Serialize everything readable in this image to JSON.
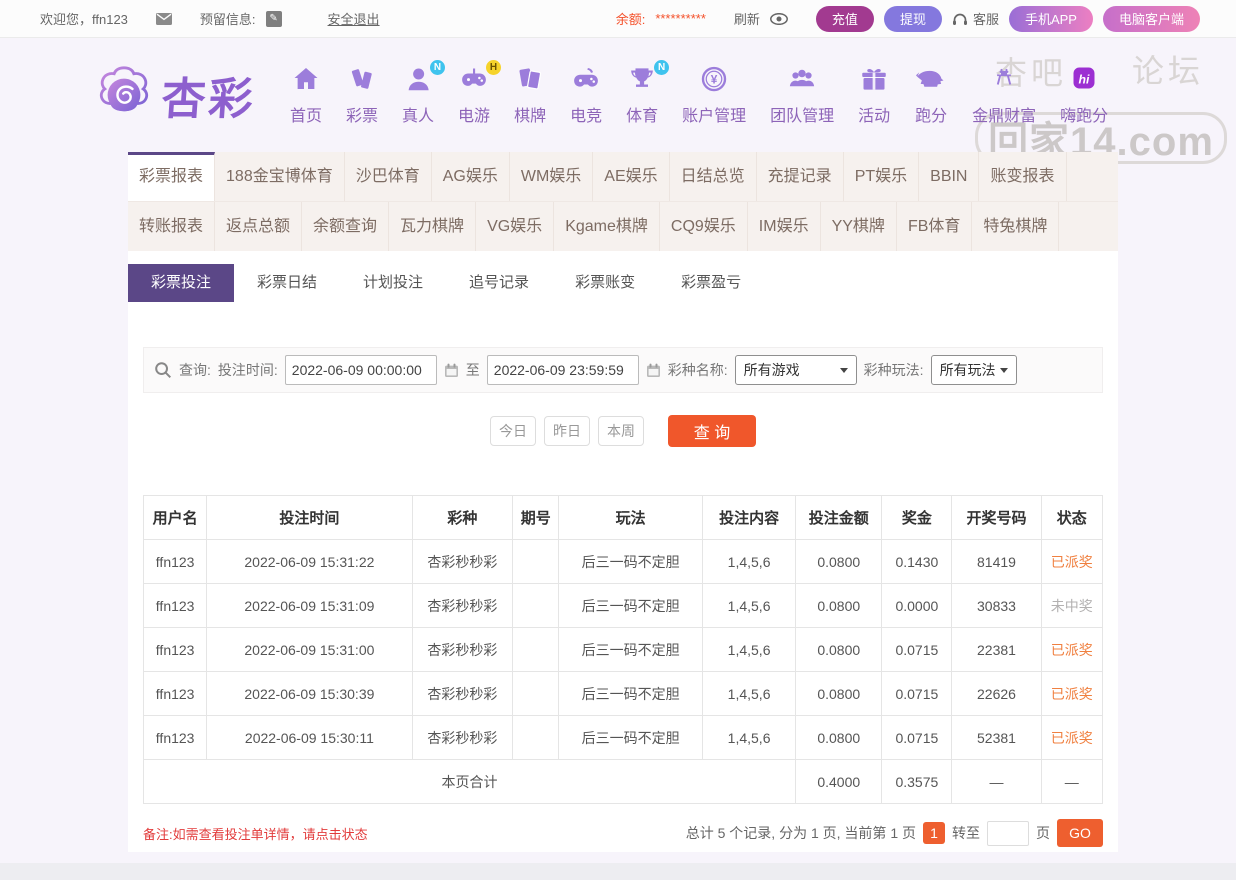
{
  "colors": {
    "brand_purple": "#5b4787",
    "nav_purple": "#8d64b8",
    "accent_orange": "#f0572b",
    "status_paid": "#f08040",
    "status_lost": "#b3b1b1",
    "balance_red": "#f4512b",
    "deposit_bg": "#a23a90",
    "withdraw_bg": "#8478de"
  },
  "topbar": {
    "welcome": "欢迎您，ffn123",
    "reserved_label": "预留信息:",
    "logout": "安全退出",
    "balance_label": "余额:",
    "balance_value": "**********",
    "refresh": "刷新",
    "deposit": "充值",
    "withdraw": "提现",
    "service": "客服",
    "mobile_app": "手机APP",
    "pc_client": "电脑客户端"
  },
  "header": {
    "logo_text": "杏彩",
    "nav": [
      {
        "label": "首页"
      },
      {
        "label": "彩票"
      },
      {
        "label": "真人",
        "badge": "N"
      },
      {
        "label": "电游",
        "badge": "H"
      },
      {
        "label": "棋牌"
      },
      {
        "label": "电竞"
      },
      {
        "label": "体育",
        "badge": "N"
      },
      {
        "label": "账户管理"
      },
      {
        "label": "团队管理"
      },
      {
        "label": "活动"
      },
      {
        "label": "跑分"
      },
      {
        "label": "金鼎财富"
      },
      {
        "label": "嗨跑分"
      }
    ],
    "watermark": {
      "left": "杏吧",
      "right": "论坛",
      "center": "回家14.com"
    }
  },
  "tabs_row1": [
    "彩票报表",
    "188金宝博体育",
    "沙巴体育",
    "AG娱乐",
    "WM娱乐",
    "AE娱乐",
    "日结总览",
    "充提记录",
    "PT娱乐",
    "BBIN",
    "账变报表"
  ],
  "tabs_row2": [
    "转账报表",
    "返点总额",
    "余额查询",
    "瓦力棋牌",
    "VG娱乐",
    "Kgame棋牌",
    "CQ9娱乐",
    "IM娱乐",
    "YY棋牌",
    "FB体育",
    "特兔棋牌"
  ],
  "subtabs": [
    "彩票投注",
    "彩票日结",
    "计划投注",
    "追号记录",
    "彩票账变",
    "彩票盈亏"
  ],
  "filters": {
    "query_label": "查询:",
    "time_label": "投注时间:",
    "time_from": "2022-06-09 00:00:00",
    "to_label": "至",
    "time_to": "2022-06-09 23:59:59",
    "lottery_label": "彩种名称:",
    "lottery_value": "所有游戏",
    "play_label": "彩种玩法:",
    "play_value": "所有玩法"
  },
  "quick": {
    "today": "今日",
    "yesterday": "昨日",
    "week": "本周",
    "search": "查 询"
  },
  "table": {
    "headers": [
      "用户名",
      "投注时间",
      "彩种",
      "期号",
      "玩法",
      "投注内容",
      "投注金额",
      "奖金",
      "开奖号码",
      "状态"
    ],
    "rows": [
      {
        "username": "ffn123",
        "time": "2022-06-09 15:31:22",
        "lottery": "杏彩秒秒彩",
        "period": "",
        "play": "后三一码不定胆",
        "content": "1,4,5,6",
        "amount": "0.0800",
        "prize": "0.1430",
        "numbers": "81419",
        "status": "已派奖"
      },
      {
        "username": "ffn123",
        "time": "2022-06-09 15:31:09",
        "lottery": "杏彩秒秒彩",
        "period": "",
        "play": "后三一码不定胆",
        "content": "1,4,5,6",
        "amount": "0.0800",
        "prize": "0.0000",
        "numbers": "30833",
        "status": "未中奖"
      },
      {
        "username": "ffn123",
        "time": "2022-06-09 15:31:00",
        "lottery": "杏彩秒秒彩",
        "period": "",
        "play": "后三一码不定胆",
        "content": "1,4,5,6",
        "amount": "0.0800",
        "prize": "0.0715",
        "numbers": "22381",
        "status": "已派奖"
      },
      {
        "username": "ffn123",
        "time": "2022-06-09 15:30:39",
        "lottery": "杏彩秒秒彩",
        "period": "",
        "play": "后三一码不定胆",
        "content": "1,4,5,6",
        "amount": "0.0800",
        "prize": "0.0715",
        "numbers": "22626",
        "status": "已派奖"
      },
      {
        "username": "ffn123",
        "time": "2022-06-09 15:30:11",
        "lottery": "杏彩秒秒彩",
        "period": "",
        "play": "后三一码不定胆",
        "content": "1,4,5,6",
        "amount": "0.0800",
        "prize": "0.0715",
        "numbers": "52381",
        "status": "已派奖"
      }
    ],
    "total": {
      "label": "本页合计",
      "amount": "0.4000",
      "prize": "0.3575",
      "dash": "—"
    }
  },
  "footer": {
    "note": "备注:如需查看投注单详情，请点击状态",
    "pagination_text": "总计 5 个记录, 分为 1 页, 当前第 1 页",
    "current_page": "1",
    "goto_label": "转至",
    "page_suffix": "页",
    "go": "GO"
  }
}
